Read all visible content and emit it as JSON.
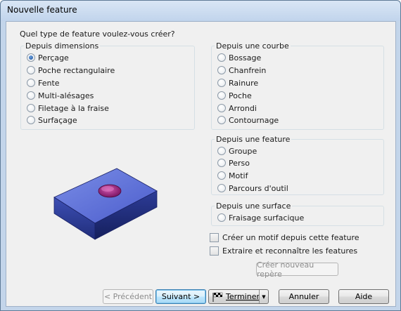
{
  "window": {
    "title": "Nouvelle feature"
  },
  "question": "Quel type de feature voulez-vous créer?",
  "groups": {
    "dimensions": {
      "title": "Depuis dimensions",
      "options": [
        "Perçage",
        "Poche rectangulaire",
        "Fente",
        "Multi-alésages",
        "Filetage à la fraise",
        "Surfaçage"
      ]
    },
    "courbe": {
      "title": "Depuis une courbe",
      "options": [
        "Bossage",
        "Chanfrein",
        "Rainure",
        "Poche",
        "Arrondi",
        "Contournage"
      ]
    },
    "feature": {
      "title": "Depuis une feature",
      "options": [
        "Groupe",
        "Perso",
        "Motif",
        "Parcours d'outil"
      ]
    },
    "surface": {
      "title": "Depuis une surface",
      "options": [
        "Fraisage surfacique"
      ]
    }
  },
  "selected_option": "Perçage",
  "checkboxes": {
    "motif": "Créer un motif depuis cette feature",
    "extraire": "Extraire et reconnaître les features"
  },
  "buttons": {
    "new_frame": "Créer nouveau repère",
    "previous": "< Précédent",
    "next": "Suivant >",
    "finish": "Terminer",
    "cancel": "Annuler",
    "help": "Aide"
  },
  "colors": {
    "block_top": "#5d6fd6",
    "block_side": "#2b3b94",
    "hole": "#a0287e",
    "accent": "#3c7fb1"
  },
  "icons": {
    "finish_icon": "checkered-flag-icon",
    "dropdown": "chevron-down-icon"
  }
}
